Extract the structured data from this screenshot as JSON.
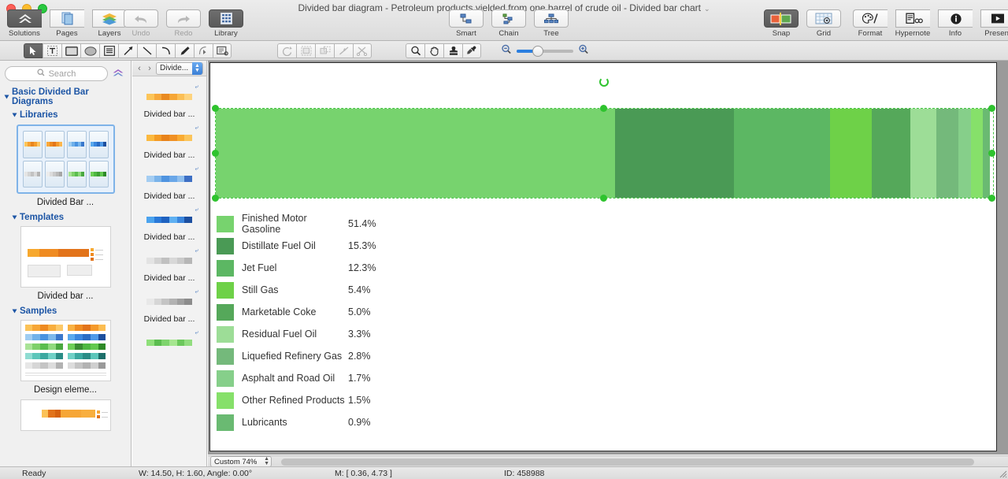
{
  "window": {
    "title": "Divided bar diagram - Petroleum products yielded from one barrel of crude oil - Divided bar chart",
    "title_chevron": "⌄"
  },
  "toolbar": {
    "left_group": [
      {
        "label": "Solutions",
        "icon": "solutions-icon",
        "active": true
      },
      {
        "label": "Pages",
        "icon": "pages-icon",
        "active": false
      },
      {
        "label": "Layers",
        "icon": "layers-icon",
        "active": false
      }
    ],
    "history_group": [
      {
        "label": "Undo",
        "icon": "undo-arrow-icon",
        "disabled": true
      },
      {
        "label": "Redo",
        "icon": "redo-arrow-icon",
        "disabled": true
      },
      {
        "label": "Library",
        "icon": "library-grid-icon",
        "active": true
      }
    ],
    "layout_group": [
      {
        "label": "Smart",
        "icon": "smart-connector-icon"
      },
      {
        "label": "Chain",
        "icon": "chain-connector-icon"
      },
      {
        "label": "Tree",
        "icon": "tree-layout-icon"
      }
    ],
    "view_group": [
      {
        "label": "Snap",
        "icon": "snap-icon",
        "active": true
      },
      {
        "label": "Grid",
        "icon": "grid-icon",
        "active": false
      }
    ],
    "inspector_group": [
      {
        "label": "Format",
        "icon": "format-palette-icon"
      },
      {
        "label": "Hypernote",
        "icon": "hypernote-icon"
      },
      {
        "label": "Info",
        "icon": "info-icon"
      },
      {
        "label": "Present",
        "icon": "present-icon"
      }
    ]
  },
  "tools": {
    "draw": [
      {
        "name": "select-arrow-tool",
        "selected": true
      },
      {
        "name": "text-tool",
        "selected": false
      },
      {
        "name": "rectangle-tool",
        "selected": false
      },
      {
        "name": "ellipse-tool",
        "selected": false
      },
      {
        "name": "note-tool",
        "selected": false
      },
      {
        "name": "arrow-line-tool",
        "selected": false
      },
      {
        "name": "line-tool",
        "selected": false
      },
      {
        "name": "curve-tool",
        "selected": false
      },
      {
        "name": "pen-tool",
        "selected": false
      },
      {
        "name": "bezier-edit-tool",
        "selected": false
      },
      {
        "name": "callout-tool",
        "selected": false
      }
    ],
    "edit": [
      {
        "name": "rotate-tool",
        "disabled": true
      },
      {
        "name": "group-tool",
        "disabled": true
      },
      {
        "name": "ungroup-tool",
        "disabled": true
      },
      {
        "name": "split-tool",
        "disabled": true
      },
      {
        "name": "cut-tool",
        "disabled": true
      }
    ],
    "view": [
      {
        "name": "zoom-tool",
        "disabled": false
      },
      {
        "name": "hand-tool",
        "disabled": false
      },
      {
        "name": "stamp-tool",
        "disabled": false
      },
      {
        "name": "eyedropper-tool",
        "disabled": false
      }
    ],
    "zoom_slider": {
      "min_icon": "zoom-out-icon",
      "max_icon": "zoom-in-icon",
      "position_pct": 28
    }
  },
  "sidebar": {
    "search": {
      "placeholder": "Search",
      "value": "",
      "icon": "search-icon"
    },
    "root_label": "Basic Divided Bar Diagrams",
    "sections": [
      {
        "label": "Libraries",
        "item_caption": "Divided Bar ..."
      },
      {
        "label": "Templates",
        "item_caption": "Divided bar ..."
      },
      {
        "label": "Samples",
        "item_caption": "Design eleme..."
      }
    ]
  },
  "pages": {
    "selected": "Divide...",
    "prev_icon": "chevron-left-icon",
    "next_icon": "chevron-right-icon",
    "items": [
      {
        "caption": "Divided bar ...",
        "colors": [
          "#fcc559",
          "#f7a93c",
          "#e98a22",
          "#f6a636",
          "#fbbf55",
          "#fdd37e"
        ]
      },
      {
        "caption": "Divided bar ...",
        "colors": [
          "#fbb93f",
          "#f49b25",
          "#e8831b",
          "#f09024",
          "#f9ab32",
          "#fbc45a"
        ]
      },
      {
        "caption": "Divided bar ...",
        "colors": [
          "#a4cdf2",
          "#7bb4ea",
          "#4f94e0",
          "#6aa7e8",
          "#8fbfee",
          "#3d6fc4"
        ]
      },
      {
        "caption": "Divided bar ...",
        "colors": [
          "#4ba3ee",
          "#2a79d8",
          "#1f62c0",
          "#5fb0f2",
          "#3b86dd",
          "#1c4fa0"
        ]
      },
      {
        "caption": "Divided bar ...",
        "colors": [
          "#e3e3e3",
          "#d2d2d2",
          "#c0c0c0",
          "#d8d8d8",
          "#cacaca",
          "#b6b6b6"
        ]
      },
      {
        "caption": "Divided bar ...",
        "colors": [
          "#e8e8e8",
          "#d6d6d6",
          "#c4c4c4",
          "#b2b2b2",
          "#9f9f9f",
          "#8c8c8c"
        ]
      },
      {
        "caption": "Divided bar ...",
        "colors": [
          "#8fe07a",
          "#5bbd4f",
          "#7ed46d",
          "#a6e690",
          "#6cc85c",
          "#92dd7f"
        ]
      }
    ]
  },
  "chart_data": {
    "type": "bar",
    "orientation": "horizontal-stacked",
    "title": "Petroleum products yielded from one barrel of crude oil",
    "unit": "%",
    "categories": [
      "Finished Motor Gasoline",
      "Distillate Fuel Oil",
      "Jet Fuel",
      "Still Gas",
      "Marketable Coke",
      "Residual Fuel Oil",
      "Liquefied Refinery Gas",
      "Asphalt and Road Oil",
      "Other Refined Products",
      "Lubricants"
    ],
    "values": [
      51.4,
      15.3,
      12.3,
      5.4,
      5.0,
      3.3,
      2.8,
      1.7,
      1.5,
      0.9
    ],
    "value_labels": [
      "51.4%",
      "15.3%",
      "12.3%",
      "5.4%",
      "5.0%",
      "3.3%",
      "2.8%",
      "1.7%",
      "1.5%",
      "0.9%"
    ],
    "colors": [
      "#77d36e",
      "#4a9a55",
      "#5cb763",
      "#6ed148",
      "#55a85a",
      "#9ddd97",
      "#74b97b",
      "#86cf8a",
      "#86e06a",
      "#6aba72"
    ],
    "legend_position": "below",
    "grid": false
  },
  "selection": {
    "handle_color": "#2ec32e",
    "dash_color": "#43c442",
    "rotate_handle_icon": "rotate-handle-icon"
  },
  "bottom": {
    "zoom_value": "Custom 74%",
    "status": "Ready",
    "dimensions": "W: 14.50,  H: 1.60,  Angle: 0.00°",
    "mouse": "M: [ 0.36, 4.73 ]",
    "object_id": "ID: 458988"
  }
}
